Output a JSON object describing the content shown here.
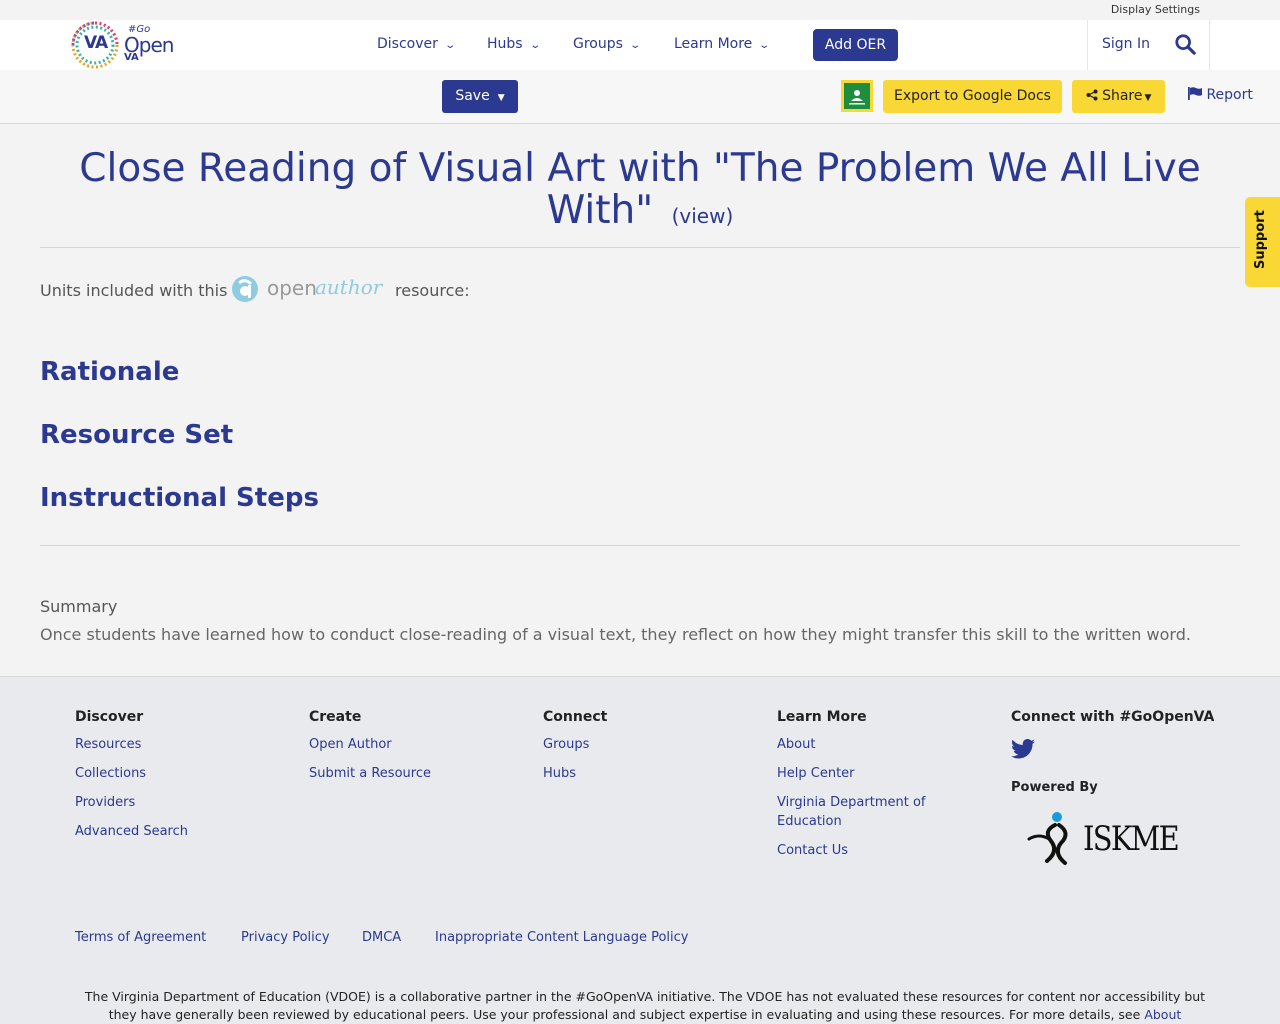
{
  "topbar": {
    "display_settings": "Display Settings"
  },
  "logo": {
    "va": "VA",
    "go": "#Go",
    "open": "Open",
    "va_small": "VA"
  },
  "nav": {
    "items": [
      {
        "label": "Discover"
      },
      {
        "label": "Hubs"
      },
      {
        "label": "Groups"
      },
      {
        "label": "Learn More"
      }
    ],
    "add_oer": "Add OER",
    "sign_in": "Sign In"
  },
  "toolbar": {
    "save": "Save",
    "export": "Export to Google Docs",
    "share": "Share",
    "report": "Report"
  },
  "support": "Support",
  "resource": {
    "title": "Close Reading of Visual Art with \"The Problem We All Live With\"",
    "view": "(view)",
    "units_before": "Units included with this",
    "units_after": "resource:",
    "openauthor_open": "open",
    "openauthor_author": "author",
    "sections": [
      "Rationale",
      "Resource Set",
      "Instructional Steps"
    ],
    "summary_label": "Summary",
    "summary_text": "Once students have learned how to conduct close-reading of a visual text, they reflect on how they might transfer this skill to the written word."
  },
  "footer": {
    "columns": [
      {
        "heading": "Discover",
        "links": [
          "Resources",
          "Collections",
          "Providers",
          "Advanced Search"
        ]
      },
      {
        "heading": "Create",
        "links": [
          "Open Author",
          "Submit a Resource"
        ]
      },
      {
        "heading": "Connect",
        "links": [
          "Groups",
          "Hubs"
        ]
      },
      {
        "heading": "Learn More",
        "links": [
          "About",
          "Help Center",
          "Virginia Department of Education",
          "Contact Us"
        ]
      },
      {
        "heading": "Connect with #GoOpenVA",
        "links": []
      }
    ],
    "powered_by": "Powered By",
    "iskme": "ISKME",
    "legal": [
      "Terms of Agreement",
      "Privacy Policy",
      "DMCA",
      "Inappropriate Content Language Policy"
    ],
    "disclaimer": "The Virginia Department of Education (VDOE) is a collaborative partner in the #GoOpenVA initiative. The VDOE has not evaluated these resources for content nor accessibility but they have generally been reviewed by educational peers. Use your professional and subject expertise in evaluating and using these resources. For more details, see",
    "disclaimer_link": "About #GoOpenVA Resources",
    "disclaimer_end": "."
  },
  "colors": {
    "brand_blue": "#2b3990",
    "yellow": "#f9d835",
    "footer_bg": "#e8eaed"
  }
}
